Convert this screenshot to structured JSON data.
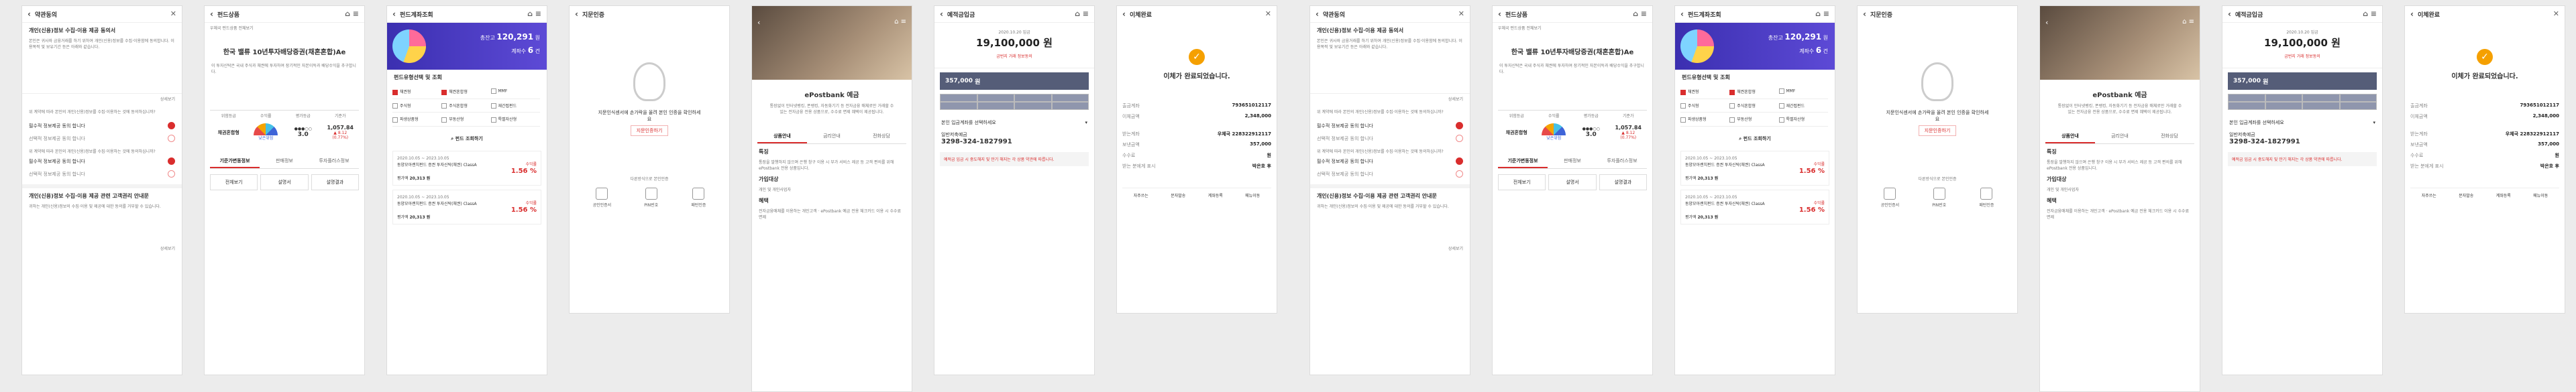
{
  "consent": {
    "title": "약관동의",
    "sec1": "개인(신용)정보 수집·이용 제공 동의서",
    "para1": "본인은 귀사와 금융거래를 하기 위하여 개인(신용)정보를 수집·이용함에 동의합니다. 이용목적 및 보유기간 등은 아래와 같습니다.",
    "detail": "상세보기",
    "items": [
      "필수적 정보제공 동의 합니다",
      "선택적 정보제공 동의 합니다"
    ],
    "para2": "위 계약에 따라 본인의 개인(신용)정보를 수집·이용하는 것에 동의하십니까?",
    "sec2": "개인(신용)정보 수집·이용 제공 관련 고객권리 안내문",
    "para3": "귀하는 개인(신용)정보의 수집·이용 및 제공에 대한 동의를 거부할 수 있습니다."
  },
  "fund": {
    "title": "펀드상품",
    "breadcrumb": "우체국 펀드상품 전체보기",
    "name": "한국 밸류 10년투자배당증권(채혼혼합)Ae",
    "para": "이 투자신탁은 국내 주식과 채권에 투자하여 장기적인 자본이득과 배당수익을 추구합니다.",
    "stats_head": [
      "위험등급",
      "수익률",
      "평가등급",
      "기준가"
    ],
    "risk_label": "채권혼합형",
    "risk_grade": "낮은위험",
    "rate_label": "3.0",
    "price": "1,057.84",
    "change": "▲ 8.12",
    "change2": "(0.77%)",
    "tabs": [
      "기준가변동정보",
      "판매정보",
      "투자플러스정보"
    ],
    "buttons": [
      "전체보기",
      "설명서",
      "설명결과"
    ]
  },
  "fundlist": {
    "title": "펀드계좌조회",
    "banner_label1": "총잔고",
    "banner_val1": "120,291",
    "banner_unit1": "원",
    "banner_label2": "계좌수",
    "banner_val2": "6",
    "banner_unit2": "건",
    "filter_title": "펀드유형선택 및 조회",
    "filters": [
      "채권형",
      "채권혼합형",
      "MMF",
      "주식형",
      "주식혼합형",
      "재간접펀드",
      "파생상품형",
      "부동산형",
      "특별자산형"
    ],
    "search_btn": "펀드 조회하기",
    "items": [
      {
        "date": "2020.10.05 ~ 2023.10.05",
        "name": "동양모아랜치펀드 증권 투자신탁(채권) ClassA",
        "rate_label": "수익률",
        "rate": "1.56 %",
        "eval_label": "평가액",
        "eval": "20,313 원"
      },
      {
        "date": "2020.10.05 ~ 2023.10.05",
        "name": "동양모아랜치펀드 증권 투자신탁(채권) ClassA",
        "rate_label": "수익률",
        "rate": "1.56 %",
        "eval_label": "평가액",
        "eval": "20,313 원"
      }
    ]
  },
  "auth": {
    "title": "지문인증",
    "msg": "지문인식센서에 손가락을 올려 본인 인증을 확인하세요",
    "retry": "지문인증하기",
    "other": "다른방식으로 본인인증",
    "methods": [
      "공인인증서",
      "PIN번호",
      "패턴인증"
    ]
  },
  "product": {
    "name": "ePostbank 예금",
    "desc": "통장없이 인터넷뱅킹, 폰뱅킹, 자동화기기 등 전자금융 매체로만 거래할 수 있는 전자금융 전용 상품으로, 수수료 면제 혜택이 제공됩니다.",
    "tabs": [
      "상품안내",
      "금리안내",
      "전화상담"
    ],
    "features_title": "특징",
    "features": "통장을 발행하지 않으며 은행 창구 이용 시 부가 서비스 제공 등 고객 편의를 위해 ePostbank 전용 상품입니다.",
    "target_title": "가입대상",
    "target": "개인 및 개인사업자",
    "benefit_title": "혜택",
    "benefit": "전자금융매체를 이용하는 개인고객 · ePostbank 예금 전용 체크카드 이용 시 수수료 면제"
  },
  "deposit": {
    "title": "예적금입금",
    "date": "2020.10.20 입금",
    "amount": "19,100,000 원",
    "link": "금번지 거래 정보동의",
    "input_val": "357,000",
    "input_unit": "원",
    "pad": [
      "+1만",
      "+5만",
      "+10만",
      "+50만",
      "+100만",
      "전액",
      "정정",
      "확인"
    ],
    "account_label": "본인 입금계좌를 선택하세요",
    "account_name": "일반저축예금",
    "account_no": "3298-324-1827991",
    "notice": "예적금 입금 시 중도해지 및 만기 해지는 각 상품 약관에 따릅니다."
  },
  "done": {
    "title": "이체완료",
    "msg": "이체가 완료되었습니다.",
    "rows": [
      {
        "k": "출금계좌",
        "v": "793651012117"
      },
      {
        "k": "이체금액",
        "v": "2,348,000"
      },
      {
        "k": "받는계좌",
        "v": "우체국 228322912117"
      },
      {
        "k": "보낸금액",
        "v": "357,000"
      },
      {
        "k": "수수료",
        "v": "원"
      },
      {
        "k": "받는 분에게 표시",
        "v": "박은호 후"
      }
    ],
    "buttons": [
      "자주쓰는",
      "문자발송",
      "계좌등록",
      "메뉴이동"
    ]
  }
}
